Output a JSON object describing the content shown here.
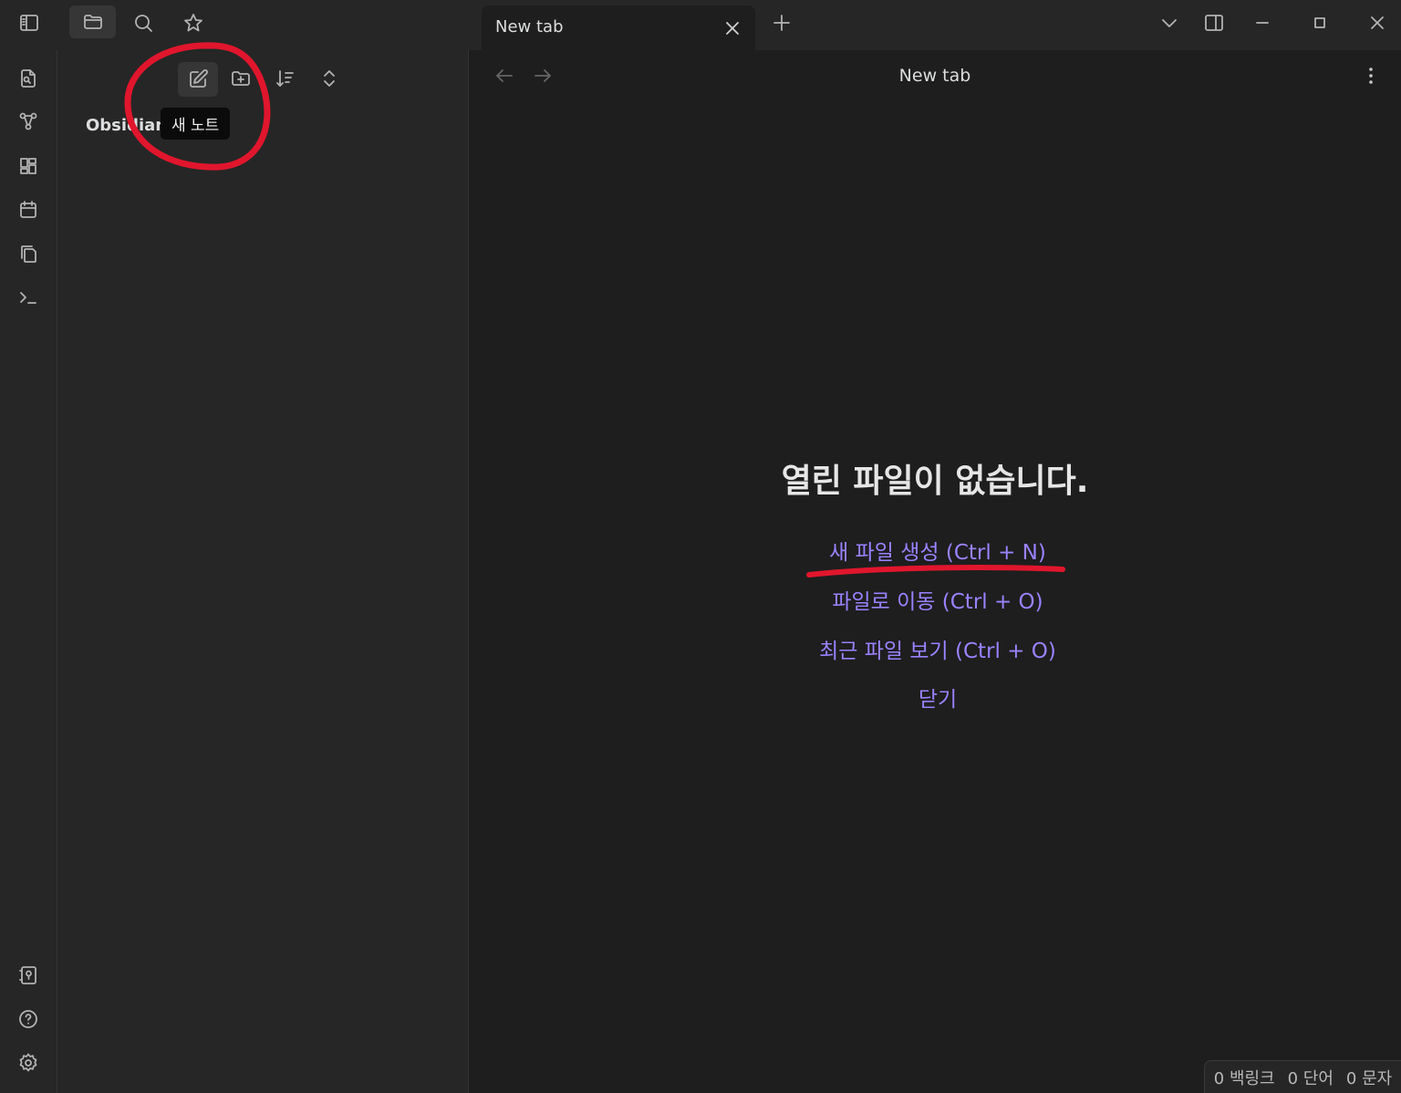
{
  "colors": {
    "accent": "#9a82ff",
    "annotation": "#e0162d",
    "background": "#1e1e1e",
    "panel": "#262626"
  },
  "titlebar": {
    "left_icons": [
      "sidebar-toggle-icon",
      "folder-icon",
      "search-icon",
      "star-icon"
    ],
    "tab": {
      "title": "New tab"
    },
    "right_icons": [
      "chevron-down-icon",
      "right-sidebar-toggle-icon",
      "minimize-icon",
      "maximize-icon",
      "close-icon"
    ]
  },
  "ribbon": {
    "top_icons": [
      "quick-switcher-icon",
      "graph-icon",
      "canvas-icon",
      "calendar-icon",
      "templates-icon",
      "command-palette-icon"
    ],
    "bottom_icons": [
      "vault-switcher-icon",
      "help-icon",
      "settings-icon"
    ]
  },
  "sidebar": {
    "toolbar_icons": [
      "new-note-icon",
      "new-folder-icon",
      "sort-icon",
      "collapse-all-icon"
    ],
    "vault_name": "Obsidian",
    "tooltip": "새 노트"
  },
  "main": {
    "nav_title": "New tab",
    "empty_state": {
      "title": "열린 파일이 없습니다.",
      "actions": [
        "새 파일 생성 (Ctrl + N)",
        "파일로 이동 (Ctrl + O)",
        "최근 파일 보기 (Ctrl + O)",
        "닫기"
      ]
    }
  },
  "status_bar": {
    "backlinks": "0 백링크",
    "words": "0 단어",
    "chars": "0 문자"
  }
}
